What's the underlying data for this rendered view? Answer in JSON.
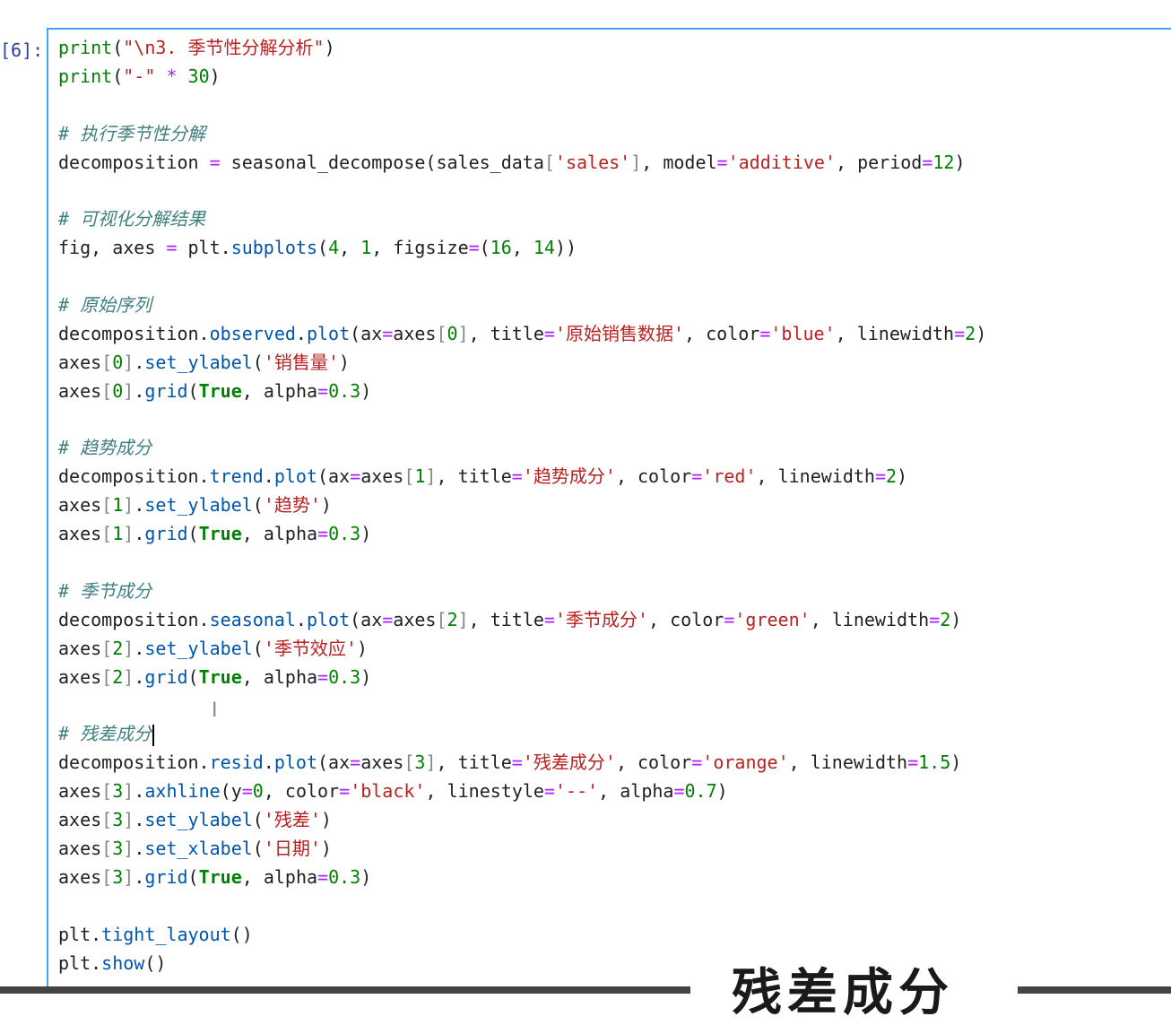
{
  "prompt": "[6]:",
  "code_lines": [
    [
      [
        "tk-builtin",
        "print"
      ],
      [
        "",
        "("
      ],
      [
        "tk-string",
        "\"\\n3. 季节性分解分析\""
      ],
      [
        "",
        ")"
      ]
    ],
    [
      [
        "tk-builtin",
        "print"
      ],
      [
        "",
        "("
      ],
      [
        "tk-string",
        "\"-\""
      ],
      [
        "",
        " "
      ],
      [
        "tk-op",
        "*"
      ],
      [
        "",
        " "
      ],
      [
        "tk-number",
        "30"
      ],
      [
        "",
        ")"
      ]
    ],
    [],
    [
      [
        "tk-comment",
        "# 执行季节性分解"
      ]
    ],
    [
      [
        "",
        "decomposition "
      ],
      [
        "tk-op",
        "="
      ],
      [
        "",
        " seasonal_decompose(sales_data"
      ],
      [
        "tk-bracket",
        "["
      ],
      [
        "tk-string",
        "'sales'"
      ],
      [
        "tk-bracket",
        "]"
      ],
      [
        "",
        ", model"
      ],
      [
        "tk-op",
        "="
      ],
      [
        "tk-string",
        "'additive'"
      ],
      [
        "",
        ", period"
      ],
      [
        "tk-op",
        "="
      ],
      [
        "tk-number",
        "12"
      ],
      [
        "",
        ")"
      ]
    ],
    [],
    [
      [
        "tk-comment",
        "# 可视化分解结果"
      ]
    ],
    [
      [
        "",
        "fig, axes "
      ],
      [
        "tk-op",
        "="
      ],
      [
        "",
        " plt."
      ],
      [
        "tk-attr",
        "subplots"
      ],
      [
        "",
        "("
      ],
      [
        "tk-number",
        "4"
      ],
      [
        "",
        ", "
      ],
      [
        "tk-number",
        "1"
      ],
      [
        "",
        ", figsize"
      ],
      [
        "tk-op",
        "="
      ],
      [
        "",
        "("
      ],
      [
        "tk-number",
        "16"
      ],
      [
        "",
        ", "
      ],
      [
        "tk-number",
        "14"
      ],
      [
        "",
        "))"
      ]
    ],
    [],
    [
      [
        "tk-comment",
        "# 原始序列"
      ]
    ],
    [
      [
        "",
        "decomposition."
      ],
      [
        "tk-attr",
        "observed"
      ],
      [
        "",
        "."
      ],
      [
        "tk-attr",
        "plot"
      ],
      [
        "",
        "(ax"
      ],
      [
        "tk-op",
        "="
      ],
      [
        "",
        "axes"
      ],
      [
        "tk-bracket",
        "["
      ],
      [
        "tk-number",
        "0"
      ],
      [
        "tk-bracket",
        "]"
      ],
      [
        "",
        ", title"
      ],
      [
        "tk-op",
        "="
      ],
      [
        "tk-string",
        "'原始销售数据'"
      ],
      [
        "",
        ", color"
      ],
      [
        "tk-op",
        "="
      ],
      [
        "tk-string",
        "'blue'"
      ],
      [
        "",
        ", linewidth"
      ],
      [
        "tk-op",
        "="
      ],
      [
        "tk-number",
        "2"
      ],
      [
        "",
        ")"
      ]
    ],
    [
      [
        "",
        "axes"
      ],
      [
        "tk-bracket",
        "["
      ],
      [
        "tk-number",
        "0"
      ],
      [
        "tk-bracket",
        "]"
      ],
      [
        "",
        "."
      ],
      [
        "tk-attr",
        "set_ylabel"
      ],
      [
        "",
        "("
      ],
      [
        "tk-string",
        "'销售量'"
      ],
      [
        "",
        ")"
      ]
    ],
    [
      [
        "",
        "axes"
      ],
      [
        "tk-bracket",
        "["
      ],
      [
        "tk-number",
        "0"
      ],
      [
        "tk-bracket",
        "]"
      ],
      [
        "",
        "."
      ],
      [
        "tk-attr",
        "grid"
      ],
      [
        "",
        "("
      ],
      [
        "tk-kw",
        "True"
      ],
      [
        "",
        ", alpha"
      ],
      [
        "tk-op",
        "="
      ],
      [
        "tk-number",
        "0.3"
      ],
      [
        "",
        ")"
      ]
    ],
    [],
    [
      [
        "tk-comment",
        "# 趋势成分"
      ]
    ],
    [
      [
        "",
        "decomposition."
      ],
      [
        "tk-attr",
        "trend"
      ],
      [
        "",
        "."
      ],
      [
        "tk-attr",
        "plot"
      ],
      [
        "",
        "(ax"
      ],
      [
        "tk-op",
        "="
      ],
      [
        "",
        "axes"
      ],
      [
        "tk-bracket",
        "["
      ],
      [
        "tk-number",
        "1"
      ],
      [
        "tk-bracket",
        "]"
      ],
      [
        "",
        ", title"
      ],
      [
        "tk-op",
        "="
      ],
      [
        "tk-string",
        "'趋势成分'"
      ],
      [
        "",
        ", color"
      ],
      [
        "tk-op",
        "="
      ],
      [
        "tk-string",
        "'red'"
      ],
      [
        "",
        ", linewidth"
      ],
      [
        "tk-op",
        "="
      ],
      [
        "tk-number",
        "2"
      ],
      [
        "",
        ")"
      ]
    ],
    [
      [
        "",
        "axes"
      ],
      [
        "tk-bracket",
        "["
      ],
      [
        "tk-number",
        "1"
      ],
      [
        "tk-bracket",
        "]"
      ],
      [
        "",
        "."
      ],
      [
        "tk-attr",
        "set_ylabel"
      ],
      [
        "",
        "("
      ],
      [
        "tk-string",
        "'趋势'"
      ],
      [
        "",
        ")"
      ]
    ],
    [
      [
        "",
        "axes"
      ],
      [
        "tk-bracket",
        "["
      ],
      [
        "tk-number",
        "1"
      ],
      [
        "tk-bracket",
        "]"
      ],
      [
        "",
        "."
      ],
      [
        "tk-attr",
        "grid"
      ],
      [
        "",
        "("
      ],
      [
        "tk-kw",
        "True"
      ],
      [
        "",
        ", alpha"
      ],
      [
        "tk-op",
        "="
      ],
      [
        "tk-number",
        "0.3"
      ],
      [
        "",
        ")"
      ]
    ],
    [],
    [
      [
        "tk-comment",
        "# 季节成分"
      ]
    ],
    [
      [
        "",
        "decomposition."
      ],
      [
        "tk-attr",
        "seasonal"
      ],
      [
        "",
        "."
      ],
      [
        "tk-attr",
        "plot"
      ],
      [
        "",
        "(ax"
      ],
      [
        "tk-op",
        "="
      ],
      [
        "",
        "axes"
      ],
      [
        "tk-bracket",
        "["
      ],
      [
        "tk-number",
        "2"
      ],
      [
        "tk-bracket",
        "]"
      ],
      [
        "",
        ", title"
      ],
      [
        "tk-op",
        "="
      ],
      [
        "tk-string",
        "'季节成分'"
      ],
      [
        "",
        ", color"
      ],
      [
        "tk-op",
        "="
      ],
      [
        "tk-string",
        "'green'"
      ],
      [
        "",
        ", linewidth"
      ],
      [
        "tk-op",
        "="
      ],
      [
        "tk-number",
        "2"
      ],
      [
        "",
        ")"
      ]
    ],
    [
      [
        "",
        "axes"
      ],
      [
        "tk-bracket",
        "["
      ],
      [
        "tk-number",
        "2"
      ],
      [
        "tk-bracket",
        "]"
      ],
      [
        "",
        "."
      ],
      [
        "tk-attr",
        "set_ylabel"
      ],
      [
        "",
        "("
      ],
      [
        "tk-string",
        "'季节效应'"
      ],
      [
        "",
        ")"
      ]
    ],
    [
      [
        "",
        "axes"
      ],
      [
        "tk-bracket",
        "["
      ],
      [
        "tk-number",
        "2"
      ],
      [
        "tk-bracket",
        "]"
      ],
      [
        "",
        "."
      ],
      [
        "tk-attr",
        "grid"
      ],
      [
        "",
        "("
      ],
      [
        "tk-kw",
        "True"
      ],
      [
        "",
        ", alpha"
      ],
      [
        "tk-op",
        "="
      ],
      [
        "tk-number",
        "0.3"
      ],
      [
        "",
        ")"
      ]
    ],
    [],
    [
      [
        "tk-comment",
        "# 残差成分"
      ],
      [
        "cursor",
        ""
      ]
    ],
    [
      [
        "",
        "decomposition."
      ],
      [
        "tk-attr",
        "resid"
      ],
      [
        "",
        "."
      ],
      [
        "tk-attr",
        "plot"
      ],
      [
        "",
        "(ax"
      ],
      [
        "tk-op",
        "="
      ],
      [
        "",
        "axes"
      ],
      [
        "tk-bracket",
        "["
      ],
      [
        "tk-number",
        "3"
      ],
      [
        "tk-bracket",
        "]"
      ],
      [
        "",
        ", title"
      ],
      [
        "tk-op",
        "="
      ],
      [
        "tk-string",
        "'残差成分'"
      ],
      [
        "",
        ", color"
      ],
      [
        "tk-op",
        "="
      ],
      [
        "tk-string",
        "'orange'"
      ],
      [
        "",
        ", linewidth"
      ],
      [
        "tk-op",
        "="
      ],
      [
        "tk-number",
        "1.5"
      ],
      [
        "",
        ")"
      ]
    ],
    [
      [
        "",
        "axes"
      ],
      [
        "tk-bracket",
        "["
      ],
      [
        "tk-number",
        "3"
      ],
      [
        "tk-bracket",
        "]"
      ],
      [
        "",
        "."
      ],
      [
        "tk-attr",
        "axhline"
      ],
      [
        "",
        "(y"
      ],
      [
        "tk-op",
        "="
      ],
      [
        "tk-number",
        "0"
      ],
      [
        "",
        ", color"
      ],
      [
        "tk-op",
        "="
      ],
      [
        "tk-string",
        "'black'"
      ],
      [
        "",
        ", linestyle"
      ],
      [
        "tk-op",
        "="
      ],
      [
        "tk-string",
        "'--'"
      ],
      [
        "",
        ", alpha"
      ],
      [
        "tk-op",
        "="
      ],
      [
        "tk-number",
        "0.7"
      ],
      [
        "",
        ")"
      ]
    ],
    [
      [
        "",
        "axes"
      ],
      [
        "tk-bracket",
        "["
      ],
      [
        "tk-number",
        "3"
      ],
      [
        "tk-bracket",
        "]"
      ],
      [
        "",
        "."
      ],
      [
        "tk-attr",
        "set_ylabel"
      ],
      [
        "",
        "("
      ],
      [
        "tk-string",
        "'残差'"
      ],
      [
        "",
        ")"
      ]
    ],
    [
      [
        "",
        "axes"
      ],
      [
        "tk-bracket",
        "["
      ],
      [
        "tk-number",
        "3"
      ],
      [
        "tk-bracket",
        "]"
      ],
      [
        "",
        "."
      ],
      [
        "tk-attr",
        "set_xlabel"
      ],
      [
        "",
        "("
      ],
      [
        "tk-string",
        "'日期'"
      ],
      [
        "",
        ")"
      ]
    ],
    [
      [
        "",
        "axes"
      ],
      [
        "tk-bracket",
        "["
      ],
      [
        "tk-number",
        "3"
      ],
      [
        "tk-bracket",
        "]"
      ],
      [
        "",
        "."
      ],
      [
        "tk-attr",
        "grid"
      ],
      [
        "",
        "("
      ],
      [
        "tk-kw",
        "True"
      ],
      [
        "",
        ", alpha"
      ],
      [
        "tk-op",
        "="
      ],
      [
        "tk-number",
        "0.3"
      ],
      [
        "",
        ")"
      ]
    ],
    [],
    [
      [
        "",
        "plt."
      ],
      [
        "tk-attr",
        "tight_layout"
      ],
      [
        "",
        "()"
      ]
    ],
    [
      [
        "",
        "plt."
      ],
      [
        "tk-attr",
        "show"
      ],
      [
        "",
        "()"
      ]
    ]
  ],
  "caption_text": "残差成分",
  "ibeam_glyph": "I"
}
